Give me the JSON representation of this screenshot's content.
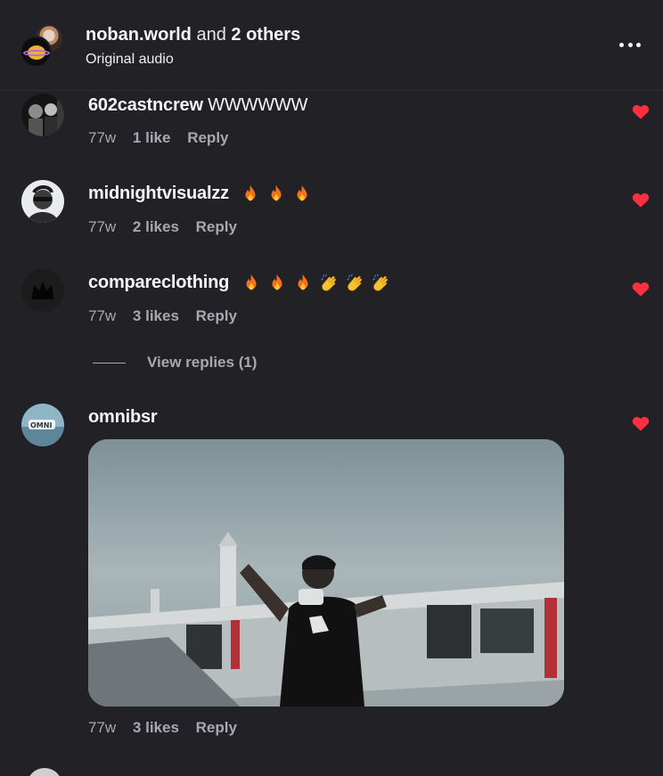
{
  "post": {
    "author": "noban.world",
    "connector": "and",
    "others": "2 others",
    "audio": "Original audio",
    "more_icon": "more-horizontal-icon"
  },
  "comments": [
    {
      "username": "602castncrew",
      "text": "WWWWWW",
      "emojis": [],
      "age": "77w",
      "likes": "1 like",
      "reply": "Reply",
      "liked": true
    },
    {
      "username": "midnightvisualzz",
      "text": "",
      "emojis": [
        "fire",
        "fire",
        "fire"
      ],
      "age": "77w",
      "likes": "2 likes",
      "reply": "Reply",
      "liked": true
    },
    {
      "username": "compareclothing",
      "text": "",
      "emojis": [
        "fire",
        "fire",
        "fire",
        "clap",
        "clap",
        "clap"
      ],
      "age": "77w",
      "likes": "3 likes",
      "reply": "Reply",
      "liked": true,
      "view_replies": "View replies (1)"
    },
    {
      "username": "omnibsr",
      "text": "",
      "emojis": [],
      "age": "77w",
      "likes": "3 likes",
      "reply": "Reply",
      "liked": true,
      "media": "gif"
    }
  ],
  "colors": {
    "background": "#212126",
    "heart": "#ff3040",
    "muted_text": "#a8a8b0"
  }
}
